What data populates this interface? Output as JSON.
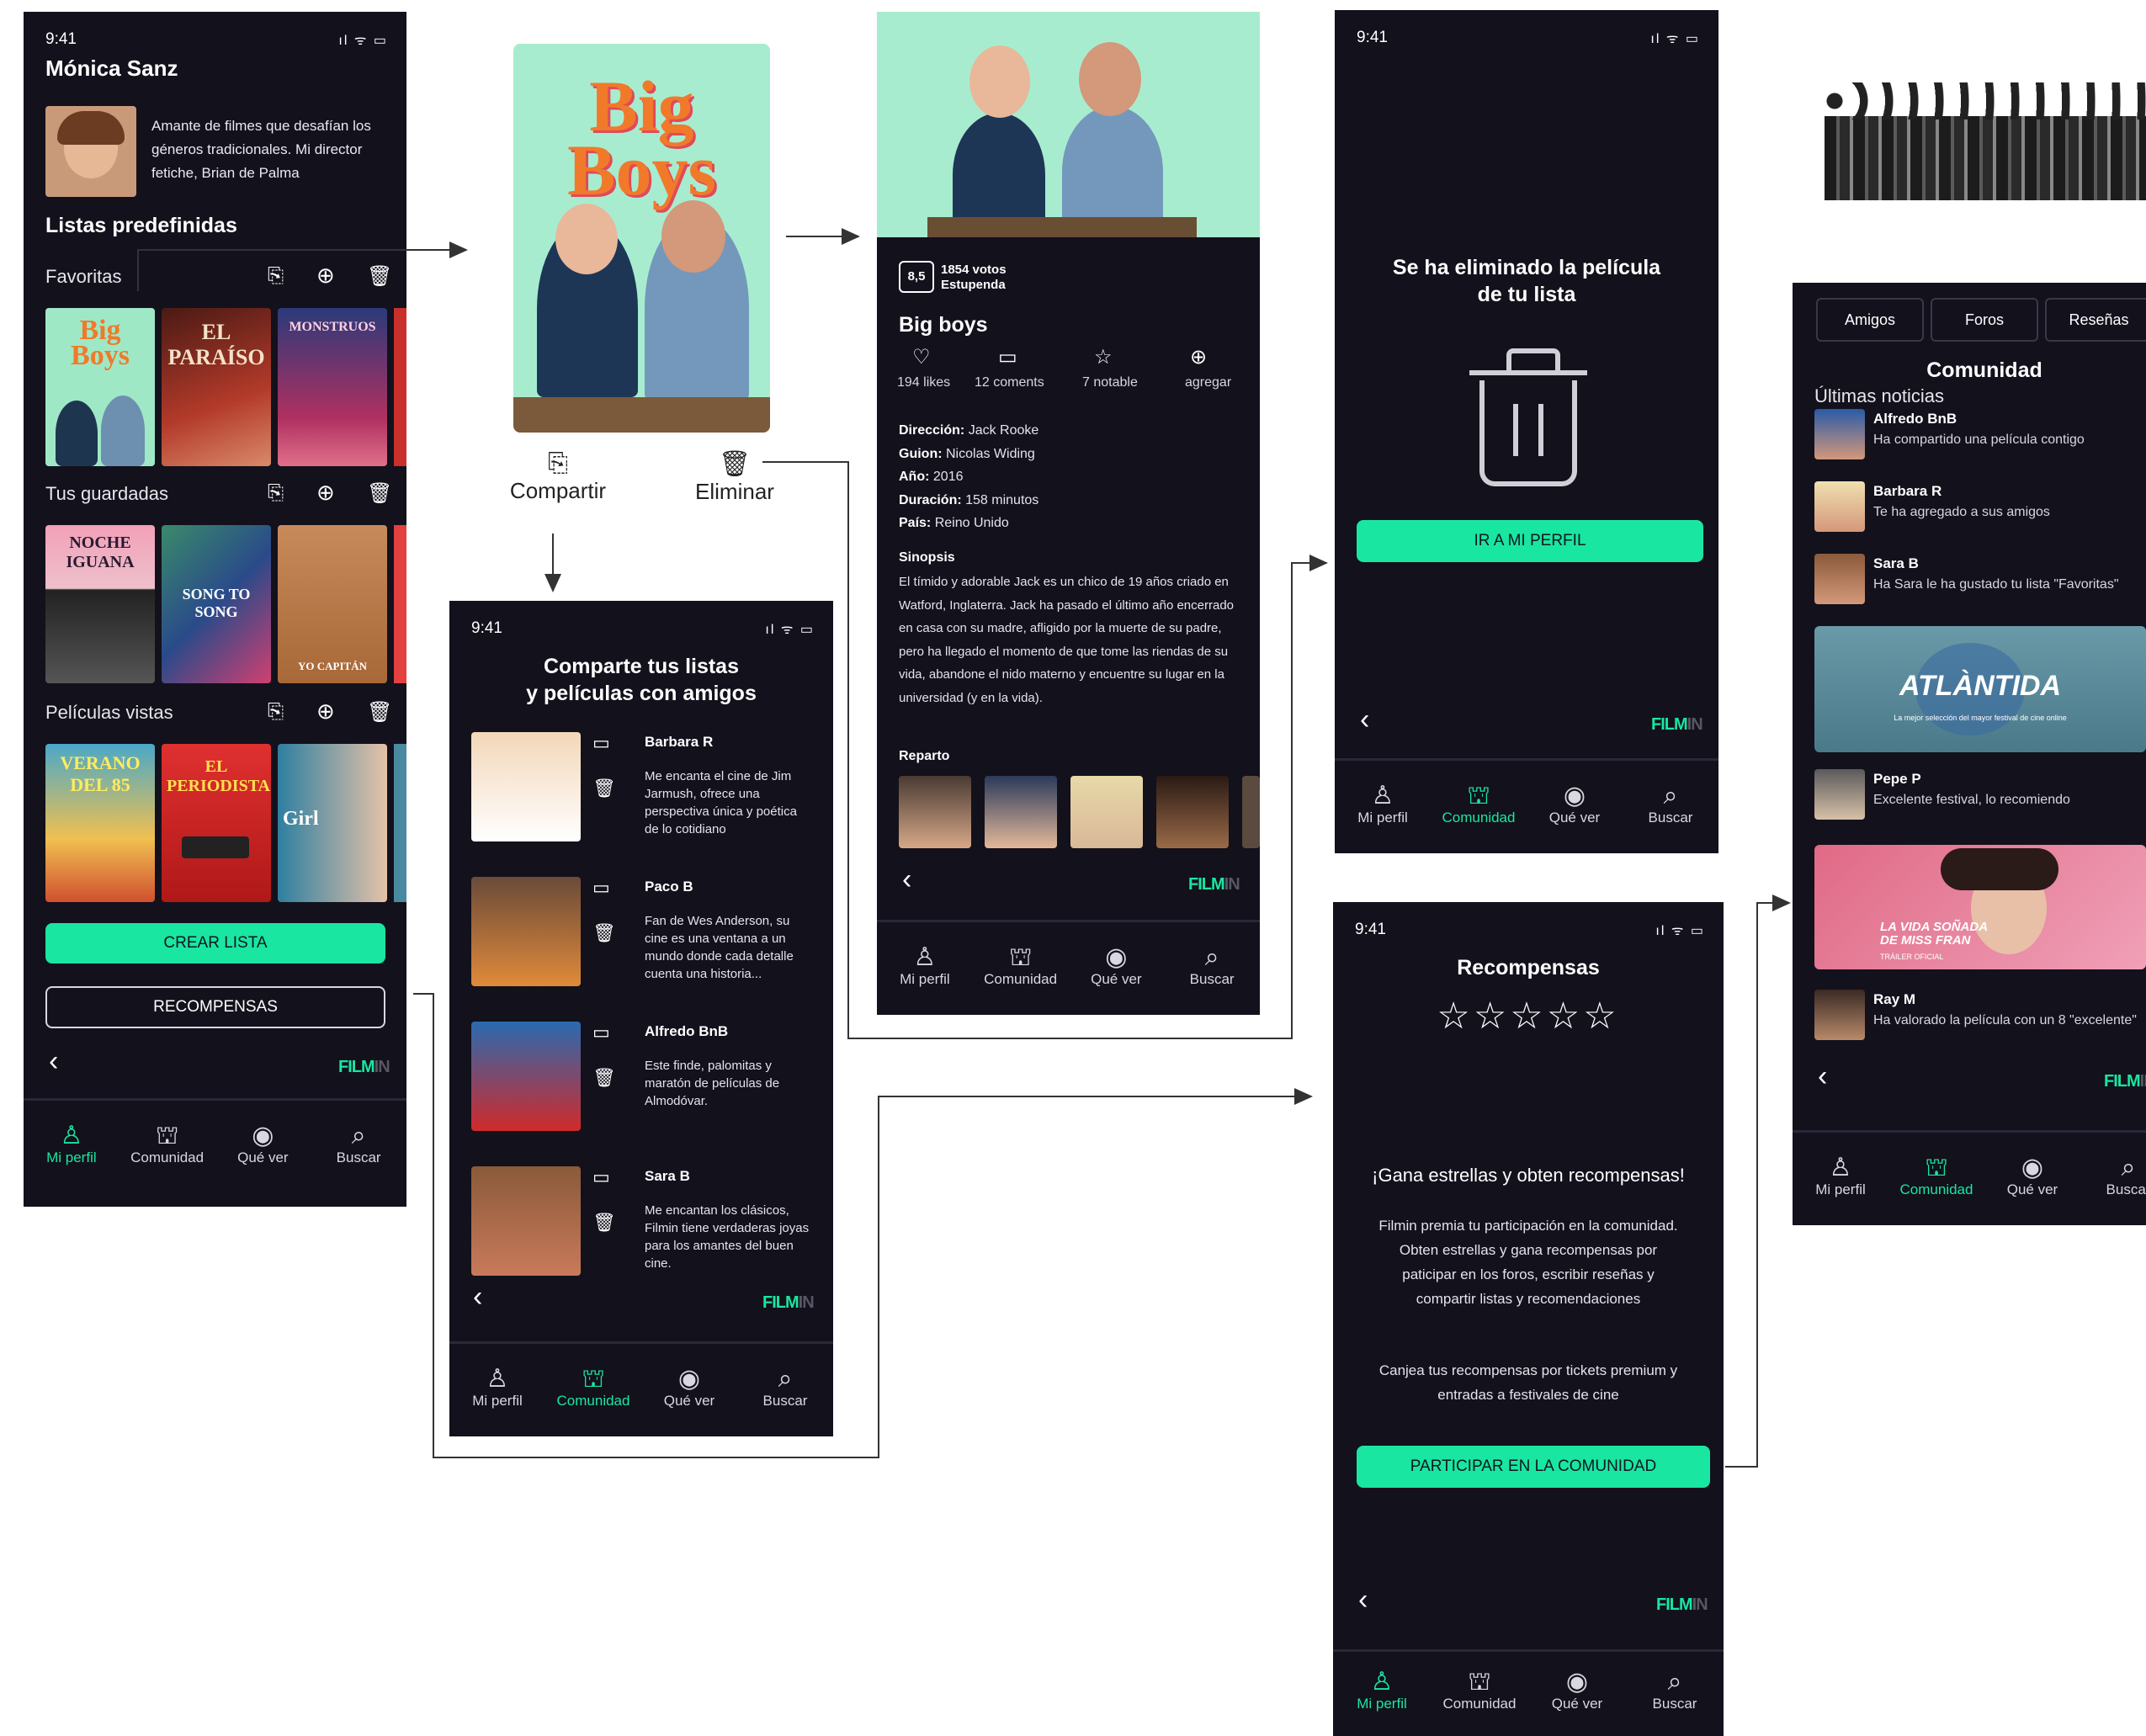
{
  "status": {
    "time": "9:41",
    "icons": "ıl ᯤ ▭"
  },
  "brand": {
    "a": "FILM",
    "b": "IN"
  },
  "tabs": [
    "Mi perfil",
    "Comunidad",
    "Qué ver",
    "Buscar"
  ],
  "profile": {
    "name": "Mónica Sanz",
    "bio": "Amante de filmes que desafían los géneros tradicionales. Mi director fetiche, Brian de Palma",
    "section": "Listas predefinidas",
    "lists": [
      {
        "title": "Favoritas",
        "posters": [
          "Big Boys",
          "EL PARAÍSO",
          "MONSTRUOS"
        ]
      },
      {
        "title": "Tus guardadas",
        "posters": [
          "NOCHE IGUANA",
          "SONG TO SONG",
          "YO CAPITÁN"
        ]
      },
      {
        "title": "Películas vistas",
        "posters": [
          "VERANO DEL 85",
          "EL PERIODISTA",
          "Girl"
        ]
      }
    ],
    "create_btn": "CREAR LISTA",
    "rewards_btn": "RECOMPENSAS"
  },
  "action": {
    "poster_title": "Big Boys",
    "share": "Compartir",
    "delete": "Eliminar"
  },
  "share": {
    "title_1": "Comparte tus listas",
    "title_2": "y películas con amigos",
    "friends": [
      {
        "name": "Barbara R",
        "text": "Me encanta el cine de Jim Jarmush, ofrece una perspectiva única y poética de lo cotidiano"
      },
      {
        "name": "Paco B",
        "text": "Fan de Wes Anderson, su cine es una ventana a un mundo donde cada detalle cuenta una historia..."
      },
      {
        "name": "Alfredo BnB",
        "text": "Este finde, palomitas y maratón de películas de Almodóvar."
      },
      {
        "name": "Sara B",
        "text": "Me encantan los clásicos, Filmin tiene verdaderas joyas para los amantes del buen cine."
      }
    ]
  },
  "detail": {
    "score": "8,5",
    "votes": "1854 votos",
    "rating_word": "Estupenda",
    "title": "Big boys",
    "stats": [
      "194 likes",
      "12 coments",
      "7 notable",
      "agregar"
    ],
    "meta": [
      {
        "k": "Dirección:",
        "v": "Jack Rooke"
      },
      {
        "k": "Guion:",
        "v": "Nicolas Widing"
      },
      {
        "k": "Año:",
        "v": "2016"
      },
      {
        "k": "Duración:",
        "v": "158 minutos"
      },
      {
        "k": "País:",
        "v": "Reino Unido"
      }
    ],
    "synopsis_label": "Sinopsis",
    "synopsis": "El tímido y adorable Jack es un chico de 19 años criado en Watford, Inglaterra. Jack ha pasado el último año encerrado en casa con su madre, afligido por la muerte de su padre, pero ha llegado el momento de que tome las riendas de su vida, abandone el nido materno y encuentre su lugar en la universidad (y en la vida).",
    "cast_label": "Reparto"
  },
  "deleted": {
    "message": "Se ha eliminado la película de tu lista",
    "button": "IR A MI PERFIL"
  },
  "rewards": {
    "title": "Recompensas",
    "stars": "☆☆☆☆☆",
    "headline": "¡Gana estrellas y obten recompensas!",
    "p1": "Filmin premia tu participación en la comunidad. Obten estrellas y gana recompensas por paticipar en los foros, escribir reseñas y compartir listas y recomendaciones",
    "p2": "Canjea tus recompensas por tickets premium y entradas a festivales de cine",
    "button": "PARTICIPAR EN LA COMUNIDAD"
  },
  "community": {
    "tabs": [
      "Amigos",
      "Foros",
      "Reseñas"
    ],
    "title": "Comunidad",
    "news_label": "Últimas noticias",
    "items": [
      {
        "name": "Alfredo BnB",
        "text": "Ha compartido una película contigo"
      },
      {
        "name": "Barbara R",
        "text": "Te ha agregado a sus amigos"
      },
      {
        "name": "Sara B",
        "text": "Ha Sara le ha gustado tu lista \"Favoritas\""
      },
      {
        "name": "Pepe P",
        "text": "Excelente festival, lo recomiendo"
      },
      {
        "name": "Ray M",
        "text": "Ha valorado la película con un 8 \"excelente\""
      }
    ],
    "banner1": "ATLÀNTIDA",
    "banner1_sub": "La mejor selección del mayor festival de cine online",
    "banner2": "LA VIDA SOÑADA DE MISS FRAN",
    "banner2_sub": "TRÁILER OFICIAL"
  }
}
